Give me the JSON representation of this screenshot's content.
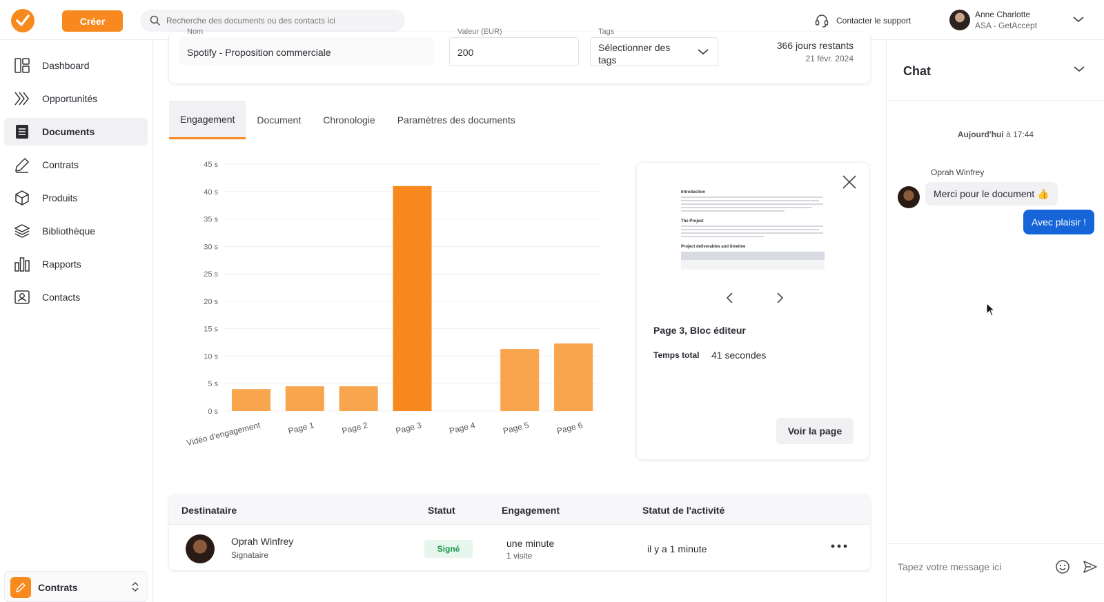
{
  "app": {
    "create_label": "Créer",
    "search_placeholder": "Recherche des documents ou des contacts ici",
    "support_label": "Contacter le support",
    "user_name": "Anne Charlotte",
    "user_org": "ASA - GetAccept",
    "accent_color": "#f7891f"
  },
  "sidebar": {
    "items": [
      {
        "label": "Dashboard",
        "icon": "dashboard-icon"
      },
      {
        "label": "Opportunités",
        "icon": "chevrons-icon"
      },
      {
        "label": "Documents",
        "icon": "document-icon",
        "active": true
      },
      {
        "label": "Contrats",
        "icon": "pen-icon"
      },
      {
        "label": "Produits",
        "icon": "box-icon"
      },
      {
        "label": "Bibliothèque",
        "icon": "layers-icon"
      },
      {
        "label": "Rapports",
        "icon": "bar-chart-icon"
      },
      {
        "label": "Contacts",
        "icon": "contact-card-icon"
      }
    ],
    "workspace_label": "Contrats"
  },
  "document": {
    "name_label_cut": "Nom",
    "name": "Spotify - Proposition commerciale",
    "value_label_cut": "Valeur (EUR)",
    "value": "200",
    "tags_label_cut": "Tags",
    "tags_placeholder": "Sélectionner des tags",
    "days_remaining": "366 jours restants",
    "expiry_date": "21 févr. 2024"
  },
  "tabs": [
    "Engagement",
    "Document",
    "Chronologie",
    "Paramètres des documents"
  ],
  "chart_data": {
    "type": "bar",
    "categories": [
      "Vidéo d'engagement",
      "Page 1",
      "Page 2",
      "Page 3",
      "Page 4",
      "Page 5",
      "Page 6"
    ],
    "values": [
      4,
      4.5,
      4.5,
      41,
      0,
      11.3,
      12.3
    ],
    "highlight_index": 3,
    "ylim": [
      0,
      45
    ],
    "yticks": [
      "0 s",
      "5 s",
      "10 s",
      "15 s",
      "20 s",
      "25 s",
      "30 s",
      "35 s",
      "40 s",
      "45 s"
    ],
    "bar_color": "#f9a54e",
    "highlight_color": "#f7891f",
    "grid": true
  },
  "preview": {
    "title": "Page 3, Bloc éditeur",
    "total_label": "Temps total",
    "total_value": "41 secondes",
    "view_button": "Voir la page",
    "thumb_headings": [
      "Introduction",
      "The Project",
      "Project deliverables and timeline"
    ]
  },
  "table": {
    "headers": [
      "Destinataire",
      "Statut",
      "Engagement",
      "Statut de l'activité"
    ],
    "row": {
      "name": "Oprah Winfrey",
      "role": "Signataire",
      "status": "Signé",
      "engagement": "une minute",
      "visits": "1 visite",
      "activity": "il y a 1 minute"
    }
  },
  "chat": {
    "title": "Chat",
    "date_bold": "Aujourd'hui",
    "date_rest": "à 17:44",
    "author": "Oprah Winfrey",
    "msg_in": "Merci pour le document 👍",
    "msg_out": "Avec plaisir !",
    "input_placeholder": "Tapez votre message ici"
  }
}
